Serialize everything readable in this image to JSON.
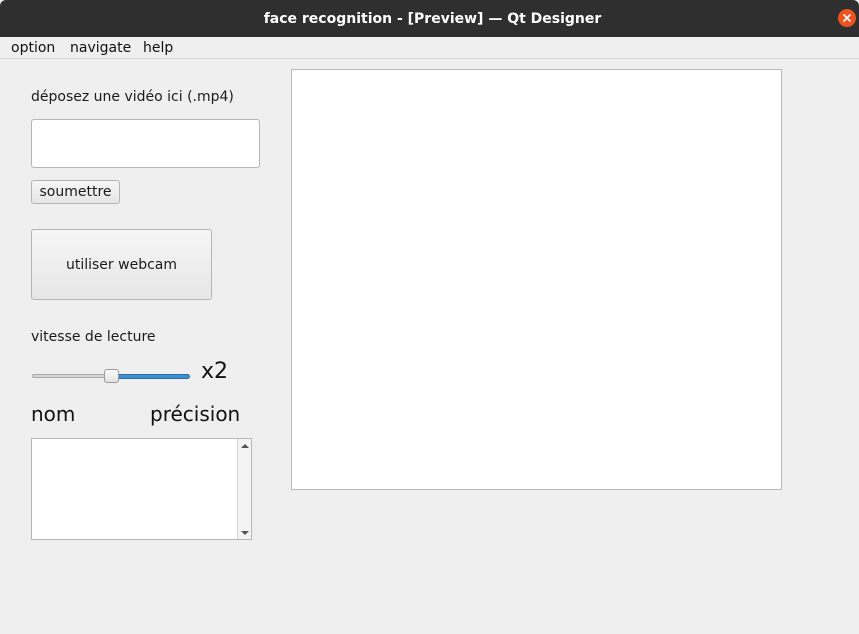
{
  "window": {
    "title": "face recognition - [Preview] — Qt Designer"
  },
  "menu": {
    "items": [
      {
        "label": "option"
      },
      {
        "label": "navigate"
      },
      {
        "label": "help"
      }
    ]
  },
  "upload": {
    "label": "déposez une vidéo ici (.mp4)",
    "value": "",
    "submit_label": "soumettre"
  },
  "webcam": {
    "button_label": "utiliser webcam"
  },
  "playback": {
    "label": "vitesse de lecture",
    "slider_level_fraction": 0.5,
    "value_label": "x2"
  },
  "results": {
    "name_header": "nom",
    "precision_header": "précision",
    "rows": []
  },
  "colors": {
    "titlebar": "#2f2f2f",
    "close_button": "#e95420",
    "slider_fill": "#3f8fd2",
    "window_bg": "#efefef"
  },
  "icons": {
    "close": "close-icon",
    "scroll_up": "scroll-up-arrow-icon",
    "scroll_down": "scroll-down-arrow-icon"
  }
}
